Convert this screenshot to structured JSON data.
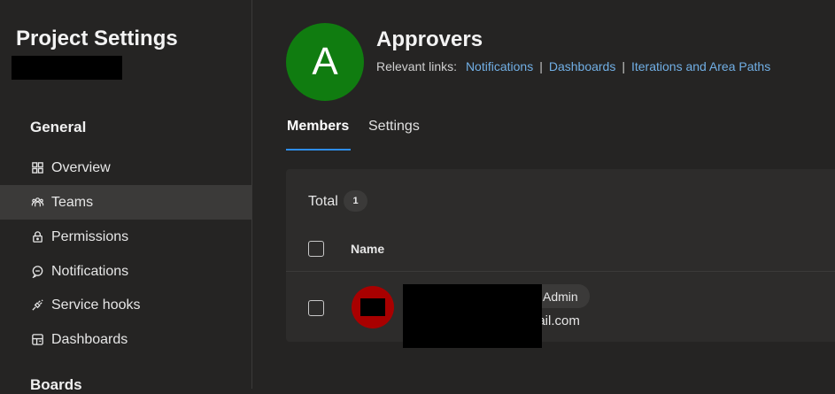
{
  "sidebar": {
    "title": "Project Settings",
    "sections": [
      {
        "label": "General"
      },
      {
        "label": "Boards"
      }
    ],
    "items": [
      {
        "label": "Overview",
        "icon": "overview-icon"
      },
      {
        "label": "Teams",
        "icon": "teams-icon",
        "selected": true
      },
      {
        "label": "Permissions",
        "icon": "lock-icon"
      },
      {
        "label": "Notifications",
        "icon": "chat-bubble-icon"
      },
      {
        "label": "Service hooks",
        "icon": "plug-icon"
      },
      {
        "label": "Dashboards",
        "icon": "dashboard-icon"
      }
    ]
  },
  "team": {
    "avatar_letter": "A",
    "name": "Approvers",
    "avatar_color": "#107c10"
  },
  "links": {
    "prefix": "Relevant links:",
    "items": [
      "Notifications",
      "Dashboards",
      "Iterations and Area Paths"
    ],
    "separator": "|",
    "color": "#71afe5"
  },
  "tabs": [
    {
      "label": "Members",
      "active": true
    },
    {
      "label": "Settings",
      "active": false
    }
  ],
  "members": {
    "total_label": "Total",
    "total_count": "1",
    "column_name": "Name",
    "rows": [
      {
        "role": "Admin",
        "email_visible": "nail.com",
        "avatar_color": "#a80000"
      }
    ]
  },
  "colors": {
    "background": "#252423",
    "panel": "#2d2c2b",
    "selected": "#3b3a39",
    "accent": "#2e8de8"
  }
}
